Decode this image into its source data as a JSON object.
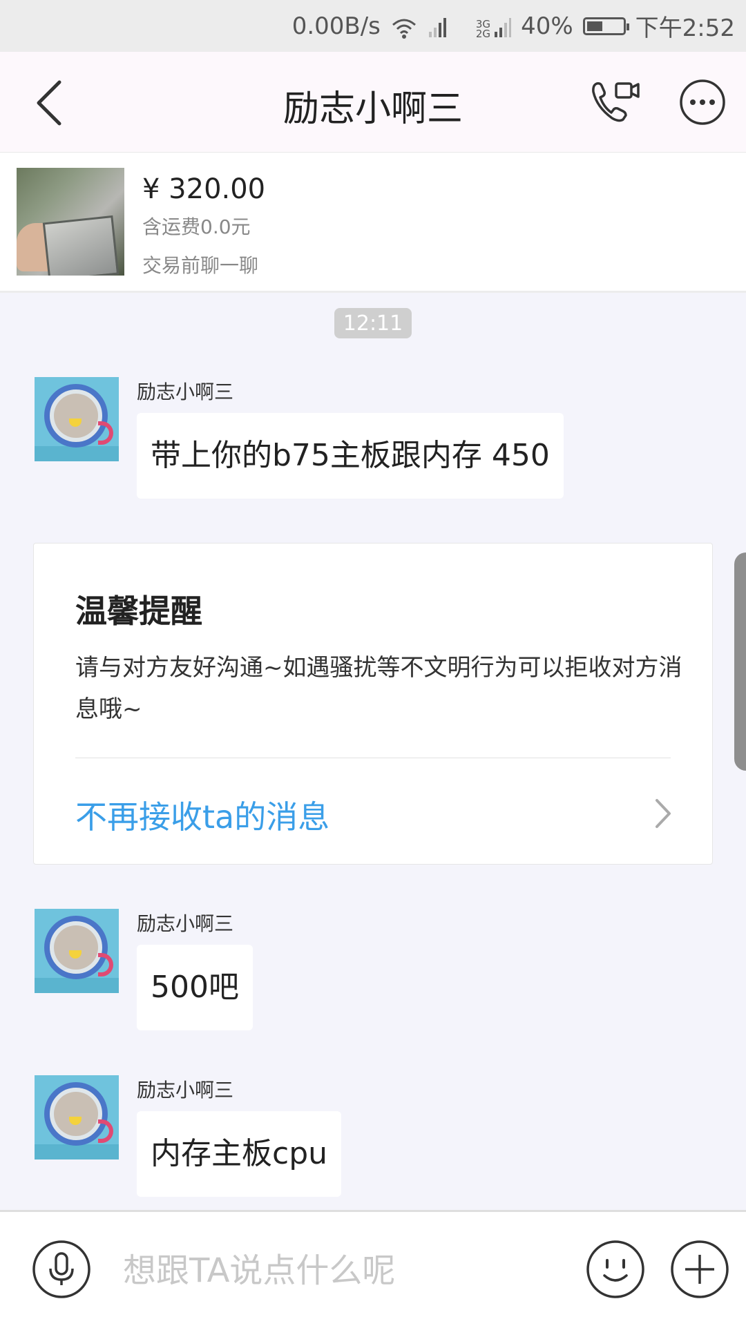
{
  "status_bar": {
    "speed": "0.00B/s",
    "network_top": "3G",
    "network_bottom": "2G",
    "battery": "40%",
    "time": "下午2:52"
  },
  "header": {
    "title": "励志小啊三"
  },
  "product": {
    "price": "¥ 320.00",
    "shipping": "含运费0.0元",
    "note": "交易前聊一聊"
  },
  "chat": {
    "timestamp": "12:11",
    "messages": [
      {
        "sender": "励志小啊三",
        "text": "带上你的b75主板跟内存 450"
      },
      {
        "sender": "励志小啊三",
        "text": "500吧"
      },
      {
        "sender": "励志小啊三",
        "text": "内存主板cpu"
      }
    ]
  },
  "reminder": {
    "title": "温馨提醒",
    "body": "请与对方友好沟通~如遇骚扰等不文明行为可以拒收对方消息哦~",
    "link": "不再接收ta的消息"
  },
  "input": {
    "placeholder": "想跟TA说点什么呢"
  },
  "colors": {
    "link": "#3a9ee8",
    "background": "#f4f4fb"
  }
}
